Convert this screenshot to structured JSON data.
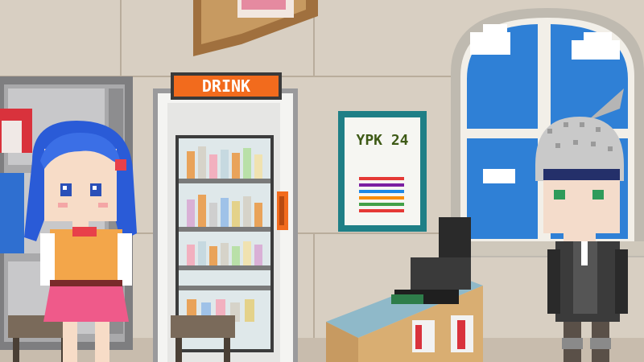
{
  "scene": {
    "location": "convenience-store-interior",
    "style": "pixel-art"
  },
  "fridge": {
    "sign_label": "DRINK"
  },
  "poster": {
    "heading": "YPK 24",
    "bar_colors": [
      "#e53935",
      "#7b1fa2",
      "#1e88e5",
      "#fb8c00",
      "#43a047",
      "#e53935"
    ]
  },
  "characters": [
    {
      "id": "blue-haired-girl",
      "hair": "#2a5bd7",
      "top": "#f3a64a",
      "skirt": "#ef5a8a"
    },
    {
      "id": "armored-knight",
      "helmet": "#c9c9c9",
      "armor": "#3b3b3b",
      "eyes": "#2e9b5a"
    }
  ],
  "colors": {
    "wall": "#d8cfc2",
    "wall_line": "#bfb3a3",
    "window_frame": "#f2efe8",
    "sky": "#2f80d6",
    "fridge_sign": "#f26b1d",
    "counter_top": "#8fb9c9",
    "counter_wood": "#c79a61"
  }
}
